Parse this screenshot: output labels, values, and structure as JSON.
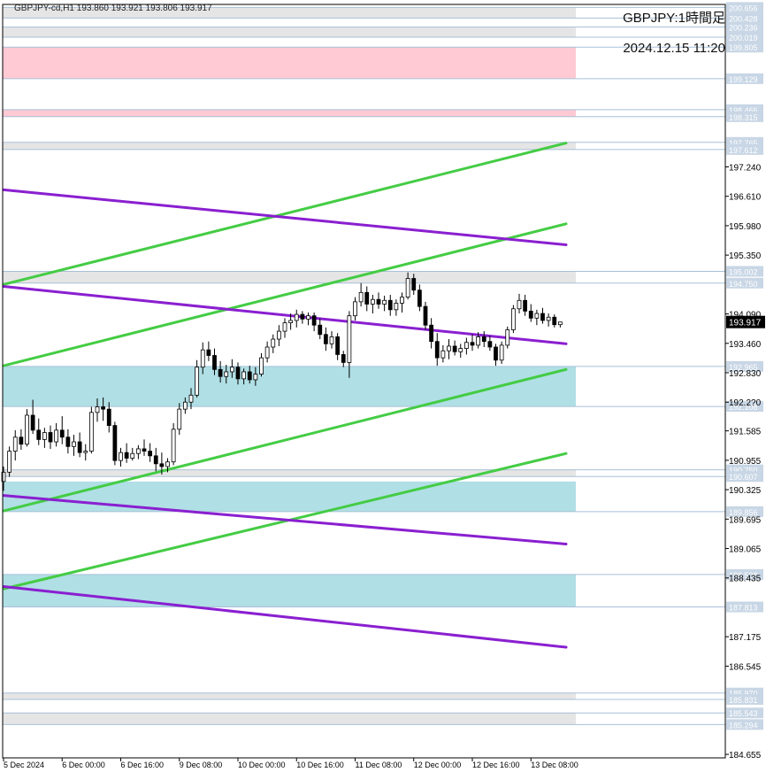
{
  "header": {
    "symbol_line": "GBPJPY-cd,H1  193.860 193.921 193.806 193.917",
    "overlay_title": "GBPJPY:1時間足",
    "overlay_date": "2024.12.15 11:20"
  },
  "colors": {
    "background": "#ffffff",
    "frame": "#000000",
    "up_candle": "#ffffff",
    "down_candle": "#000000",
    "candle_wick": "#000000",
    "zone_gray": "#e5e5e5",
    "zone_pink": "#ffcad3",
    "zone_cyan": "#b0dfe5",
    "level_line": "#a8c0d8",
    "trend_green": "#44cc44",
    "trend_purple": "#8a1fd0",
    "level_label_text": "#ffffff",
    "level_label_bg": "#c8d6e5",
    "price_tag_bg": "#000000",
    "price_tag_text": "#ffffff"
  },
  "chart_data": {
    "type": "candlestick",
    "title": "GBPJPY:1時間足",
    "ylim": [
      184.58,
      200.72
    ],
    "x_index_range": [
      0,
      96
    ],
    "y_tick_labels": [
      {
        "value": 197.24,
        "label": "197.240"
      },
      {
        "value": 196.61,
        "label": "196.610"
      },
      {
        "value": 195.98,
        "label": "195.980"
      },
      {
        "value": 195.35,
        "label": "195.350"
      },
      {
        "value": 194.09,
        "label": "194.090"
      },
      {
        "value": 193.46,
        "label": "193.460"
      },
      {
        "value": 192.83,
        "label": "192.830"
      },
      {
        "value": 192.2,
        "label": "192.2?0"
      },
      {
        "value": 191.585,
        "label": "191.585"
      },
      {
        "value": 190.955,
        "label": "190.955"
      },
      {
        "value": 190.325,
        "label": "190.325"
      },
      {
        "value": 189.695,
        "label": "189.695"
      },
      {
        "value": 189.065,
        "label": "189.065"
      },
      {
        "value": 188.435,
        "label": "188.435"
      },
      {
        "value": 187.175,
        "label": "187.175"
      },
      {
        "value": 186.545,
        "label": "186.545"
      },
      {
        "value": 184.655,
        "label": "184.655"
      }
    ],
    "x_tick_labels": [
      {
        "index": 0,
        "label": "5 Dec 2024"
      },
      {
        "index": 10,
        "label": "6 Dec 00:00"
      },
      {
        "index": 20,
        "label": "6 Dec 16:00"
      },
      {
        "index": 30,
        "label": "9 Dec 08:00"
      },
      {
        "index": 40,
        "label": "10 Dec 00:00"
      },
      {
        "index": 50,
        "label": "10 Dec 16:00"
      },
      {
        "index": 60,
        "label": "11 Dec 08:00"
      },
      {
        "index": 70,
        "label": "12 Dec 00:00"
      },
      {
        "index": 80,
        "label": "12 Dec 16:00"
      },
      {
        "index": 90,
        "label": "13 Dec 08:00"
      }
    ],
    "current_price": {
      "value": 193.917,
      "label": "193.917"
    },
    "levels": [
      {
        "value": 200.656,
        "label": "200.656"
      },
      {
        "value": 200.428,
        "label": "200.428"
      },
      {
        "value": 200.236,
        "label": "200.236"
      },
      {
        "value": 200.019,
        "label": "200.019"
      },
      {
        "value": 199.805,
        "label": "199.805"
      },
      {
        "value": 199.129,
        "label": "199.129"
      },
      {
        "value": 198.466,
        "label": "198.466"
      },
      {
        "value": 198.315,
        "label": "198.315"
      },
      {
        "value": 197.765,
        "label": "197.765"
      },
      {
        "value": 197.612,
        "label": "197.612"
      },
      {
        "value": 195.002,
        "label": "195.002"
      },
      {
        "value": 194.75,
        "label": "194.750"
      },
      {
        "value": 192.965,
        "label": "192.965"
      },
      {
        "value": 192.108,
        "label": "192.108"
      },
      {
        "value": 190.75,
        "label": "190.750"
      },
      {
        "value": 190.607,
        "label": "190.607"
      },
      {
        "value": 189.856,
        "label": "189.856"
      },
      {
        "value": 188.508,
        "label": "188.508"
      },
      {
        "value": 187.813,
        "label": "187.813"
      },
      {
        "value": 185.97,
        "label": "185.970"
      },
      {
        "value": 185.831,
        "label": "185.831"
      },
      {
        "value": 185.543,
        "label": "185.543"
      },
      {
        "value": 185.294,
        "label": "185.294"
      }
    ],
    "zones": [
      {
        "kind": "gray",
        "from": 200.428,
        "to": 200.656
      },
      {
        "kind": "gray",
        "from": 200.019,
        "to": 200.236
      },
      {
        "kind": "pink",
        "from": 199.129,
        "to": 199.805
      },
      {
        "kind": "pink",
        "from": 198.315,
        "to": 198.466
      },
      {
        "kind": "gray",
        "from": 197.612,
        "to": 197.765
      },
      {
        "kind": "gray",
        "from": 194.75,
        "to": 195.002
      },
      {
        "kind": "cyan",
        "from": 192.108,
        "to": 192.965
      },
      {
        "kind": "gray",
        "from": 190.607,
        "to": 190.75
      },
      {
        "kind": "cyan",
        "from": 189.856,
        "to": 190.5
      },
      {
        "kind": "cyan",
        "from": 187.813,
        "to": 188.508
      },
      {
        "kind": "gray",
        "from": 185.831,
        "to": 185.97
      },
      {
        "kind": "gray",
        "from": 185.294,
        "to": 185.543
      }
    ],
    "trendlines": [
      {
        "color": "green",
        "points": [
          [
            0,
            194.72
          ],
          [
            96,
            197.75
          ]
        ]
      },
      {
        "color": "green",
        "points": [
          [
            0,
            192.98
          ],
          [
            96,
            196.02
          ]
        ]
      },
      {
        "color": "green",
        "points": [
          [
            0,
            189.87
          ],
          [
            96,
            192.9
          ]
        ]
      },
      {
        "color": "green",
        "points": [
          [
            0,
            188.2
          ],
          [
            96,
            191.1
          ]
        ]
      },
      {
        "color": "purple",
        "points": [
          [
            0,
            196.75
          ],
          [
            96,
            195.57
          ]
        ]
      },
      {
        "color": "purple",
        "points": [
          [
            0,
            194.68
          ],
          [
            96,
            193.45
          ]
        ]
      },
      {
        "color": "purple",
        "points": [
          [
            0,
            190.2
          ],
          [
            96,
            189.16
          ]
        ]
      },
      {
        "color": "purple",
        "points": [
          [
            0,
            188.25
          ],
          [
            96,
            186.95
          ]
        ]
      }
    ],
    "candles": [
      [
        190.5,
        190.82,
        190.3,
        190.7
      ],
      [
        190.7,
        191.25,
        190.6,
        191.15
      ],
      [
        191.15,
        191.6,
        190.95,
        191.45
      ],
      [
        191.45,
        191.62,
        191.18,
        191.3
      ],
      [
        191.3,
        192.05,
        191.25,
        191.92
      ],
      [
        191.92,
        192.25,
        191.52,
        191.6
      ],
      [
        191.6,
        191.85,
        191.28,
        191.4
      ],
      [
        191.4,
        191.65,
        191.22,
        191.55
      ],
      [
        191.55,
        191.7,
        191.2,
        191.35
      ],
      [
        191.35,
        191.75,
        191.25,
        191.6
      ],
      [
        191.6,
        191.9,
        191.3,
        191.45
      ],
      [
        191.45,
        191.62,
        191.1,
        191.25
      ],
      [
        191.25,
        191.5,
        191.05,
        191.35
      ],
      [
        191.35,
        191.55,
        191.02,
        191.12
      ],
      [
        191.12,
        191.3,
        190.95,
        191.15
      ],
      [
        191.15,
        192.1,
        191.1,
        191.98
      ],
      [
        191.98,
        192.28,
        191.78,
        192.1
      ],
      [
        192.1,
        192.3,
        191.8,
        192.05
      ],
      [
        192.05,
        192.2,
        191.55,
        191.7
      ],
      [
        191.7,
        191.78,
        190.85,
        190.95
      ],
      [
        190.95,
        191.22,
        190.82,
        191.12
      ],
      [
        191.12,
        191.32,
        190.9,
        191.0
      ],
      [
        191.0,
        191.22,
        190.95,
        191.1
      ],
      [
        191.1,
        191.28,
        190.98,
        191.2
      ],
      [
        191.2,
        191.4,
        191.05,
        191.15
      ],
      [
        191.15,
        191.32,
        190.92,
        191.05
      ],
      [
        191.05,
        191.22,
        190.72,
        190.88
      ],
      [
        190.88,
        191.12,
        190.65,
        190.82
      ],
      [
        190.82,
        191.0,
        190.7,
        190.92
      ],
      [
        190.92,
        191.75,
        190.85,
        191.62
      ],
      [
        191.62,
        192.18,
        191.5,
        192.05
      ],
      [
        192.05,
        192.3,
        191.95,
        192.2
      ],
      [
        192.2,
        192.5,
        192.05,
        192.35
      ],
      [
        192.35,
        193.1,
        192.3,
        192.95
      ],
      [
        192.95,
        193.48,
        192.8,
        193.32
      ],
      [
        193.32,
        193.5,
        193.08,
        193.2
      ],
      [
        193.2,
        193.35,
        192.78,
        192.9
      ],
      [
        192.9,
        193.08,
        192.62,
        192.75
      ],
      [
        192.75,
        193.0,
        192.6,
        192.85
      ],
      [
        192.85,
        193.12,
        192.72,
        192.95
      ],
      [
        192.95,
        193.05,
        192.58,
        192.7
      ],
      [
        192.7,
        192.92,
        192.58,
        192.85
      ],
      [
        192.85,
        192.98,
        192.6,
        192.68
      ],
      [
        192.68,
        192.95,
        192.55,
        192.8
      ],
      [
        192.8,
        193.25,
        192.75,
        193.15
      ],
      [
        193.15,
        193.5,
        193.05,
        193.38
      ],
      [
        193.38,
        193.65,
        193.25,
        193.55
      ],
      [
        193.55,
        193.85,
        193.4,
        193.72
      ],
      [
        193.72,
        194.0,
        193.58,
        193.9
      ],
      [
        193.9,
        194.1,
        193.75,
        193.95
      ],
      [
        193.95,
        194.18,
        193.8,
        194.08
      ],
      [
        194.08,
        194.15,
        193.88,
        193.98
      ],
      [
        193.98,
        194.12,
        193.85,
        194.05
      ],
      [
        194.05,
        194.12,
        193.72,
        193.85
      ],
      [
        193.85,
        194.0,
        193.55,
        193.65
      ],
      [
        193.65,
        193.8,
        193.3,
        193.45
      ],
      [
        193.45,
        193.72,
        193.35,
        193.6
      ],
      [
        193.6,
        193.68,
        193.1,
        193.22
      ],
      [
        193.22,
        193.3,
        192.95,
        193.05
      ],
      [
        193.05,
        194.15,
        192.72,
        194.05
      ],
      [
        194.05,
        194.45,
        193.95,
        194.35
      ],
      [
        194.35,
        194.75,
        194.25,
        194.55
      ],
      [
        194.55,
        194.68,
        194.15,
        194.3
      ],
      [
        194.3,
        194.5,
        194.1,
        194.4
      ],
      [
        194.4,
        194.55,
        194.2,
        194.3
      ],
      [
        194.3,
        194.48,
        194.15,
        194.38
      ],
      [
        194.38,
        194.5,
        194.05,
        194.18
      ],
      [
        194.18,
        194.4,
        194.05,
        194.32
      ],
      [
        194.32,
        194.55,
        194.12,
        194.45
      ],
      [
        194.45,
        194.98,
        194.4,
        194.85
      ],
      [
        194.85,
        194.95,
        194.5,
        194.6
      ],
      [
        194.6,
        194.72,
        194.15,
        194.25
      ],
      [
        194.25,
        194.35,
        193.75,
        193.85
      ],
      [
        193.85,
        194.0,
        193.35,
        193.5
      ],
      [
        193.5,
        193.68,
        192.98,
        193.15
      ],
      [
        193.15,
        193.42,
        193.05,
        193.3
      ],
      [
        193.3,
        193.55,
        193.12,
        193.4
      ],
      [
        193.4,
        193.52,
        193.2,
        193.28
      ],
      [
        193.28,
        193.45,
        193.15,
        193.35
      ],
      [
        193.35,
        193.58,
        193.22,
        193.48
      ],
      [
        193.48,
        193.65,
        193.3,
        193.42
      ],
      [
        193.42,
        193.7,
        193.35,
        193.6
      ],
      [
        193.6,
        193.72,
        193.38,
        193.5
      ],
      [
        193.5,
        193.62,
        193.3,
        193.38
      ],
      [
        193.38,
        193.45,
        192.98,
        193.1
      ],
      [
        193.1,
        193.5,
        193.02,
        193.42
      ],
      [
        193.42,
        193.82,
        193.35,
        193.75
      ],
      [
        193.75,
        194.28,
        193.68,
        194.2
      ],
      [
        194.2,
        194.52,
        194.1,
        194.38
      ],
      [
        194.38,
        194.5,
        194.05,
        194.15
      ],
      [
        194.15,
        194.3,
        193.92,
        194.0
      ],
      [
        194.0,
        194.18,
        193.85,
        194.1
      ],
      [
        194.1,
        194.22,
        193.88,
        193.95
      ],
      [
        193.95,
        194.1,
        193.82,
        194.02
      ],
      [
        194.02,
        194.08,
        193.8,
        193.86
      ],
      [
        193.86,
        193.92,
        193.8,
        193.917
      ]
    ]
  }
}
